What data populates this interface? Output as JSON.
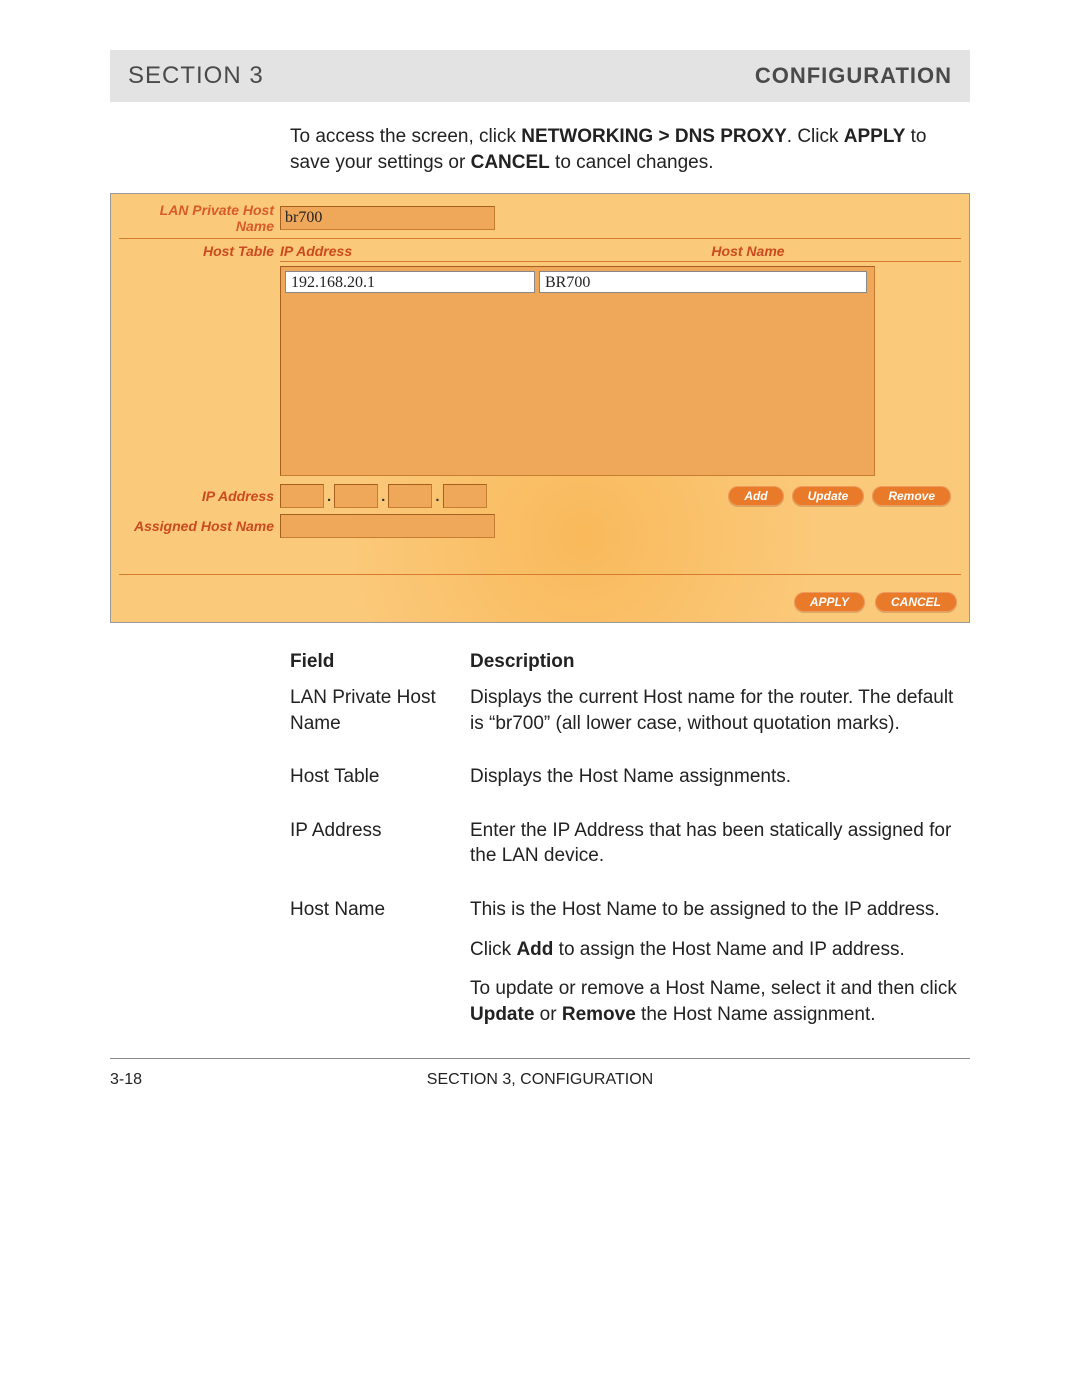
{
  "header": {
    "left": "SECTION 3",
    "right": "CONFIGURATION"
  },
  "intro": {
    "t1": "To access the screen, click ",
    "b1": "NETWORKING > DNS PROXY",
    "t2": ". Click ",
    "b2": "APPLY",
    "t3": " to save your settings or ",
    "b3": "CANCEL",
    "t4": " to cancel changes."
  },
  "panel": {
    "labels": {
      "lan_private": "LAN Private Host Name",
      "host_table": "Host Table",
      "ip_address_col": "IP Address",
      "host_name_col": "Host Name",
      "ip_address": "IP Address",
      "assigned": "Assigned Host Name"
    },
    "values": {
      "lan_private": "br700",
      "list_ip": "192.168.20.1",
      "list_hostname": "BR700",
      "octet1": "",
      "octet2": "",
      "octet3": "",
      "octet4": "",
      "assigned": ""
    },
    "buttons": {
      "add": "Add",
      "update": "Update",
      "remove": "Remove",
      "apply": "APPLY",
      "cancel": "CANCEL"
    }
  },
  "desc": {
    "head_field": "Field",
    "head_desc": "Description",
    "rows": [
      {
        "field": "LAN Private Host Name",
        "paras": [
          "Displays the current Host name for the router. The default is “br700” (all lower case, without quotation marks)."
        ]
      },
      {
        "field": "Host Table",
        "paras": [
          "Displays the Host Name assignments."
        ]
      },
      {
        "field": "IP Address",
        "paras": [
          "Enter the IP Address that has been statically assigned for the LAN device."
        ]
      },
      {
        "field": "Host Name",
        "paras": [
          "This is the Host Name to be assigned to the IP address.",
          {
            "t1": "Click ",
            "b": "Add",
            "t2": " to assign the Host Name and IP address."
          },
          {
            "t1": "To update or remove a Host Name, select it and then click ",
            "b": "Update",
            "t2": " or ",
            "b2": "Remove",
            "t3": " the Host Name assignment."
          }
        ]
      }
    ]
  },
  "footer": {
    "page": "3-18",
    "center": "SECTION 3, CONFIGURATION"
  }
}
